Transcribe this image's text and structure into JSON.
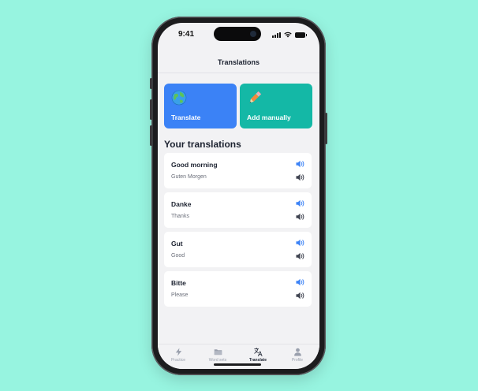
{
  "status_bar": {
    "time": "9:41"
  },
  "header": {
    "title": "Translations"
  },
  "actions": [
    {
      "label": "Translate",
      "icon": "globe-icon",
      "color": "#3b82f6"
    },
    {
      "label": "Add manually",
      "icon": "pencil-icon",
      "color": "#14b8a6"
    }
  ],
  "section": {
    "title": "Your translations"
  },
  "translations": [
    {
      "term": "Good morning",
      "translation": "Guten Morgen"
    },
    {
      "term": "Danke",
      "translation": "Thanks"
    },
    {
      "term": "Gut",
      "translation": "Good"
    },
    {
      "term": "Bitte",
      "translation": "Please"
    }
  ],
  "tabs": [
    {
      "label": "Practice",
      "icon": "lightning-icon",
      "active": false
    },
    {
      "label": "Word sets",
      "icon": "folder-icon",
      "active": false
    },
    {
      "label": "Translate",
      "icon": "translate-icon",
      "active": true
    },
    {
      "label": "Profile",
      "icon": "person-icon",
      "active": false
    }
  ],
  "colors": {
    "background": "#97f4e0",
    "speaker_primary": "#3b82f6",
    "speaker_secondary": "#3f4350"
  }
}
